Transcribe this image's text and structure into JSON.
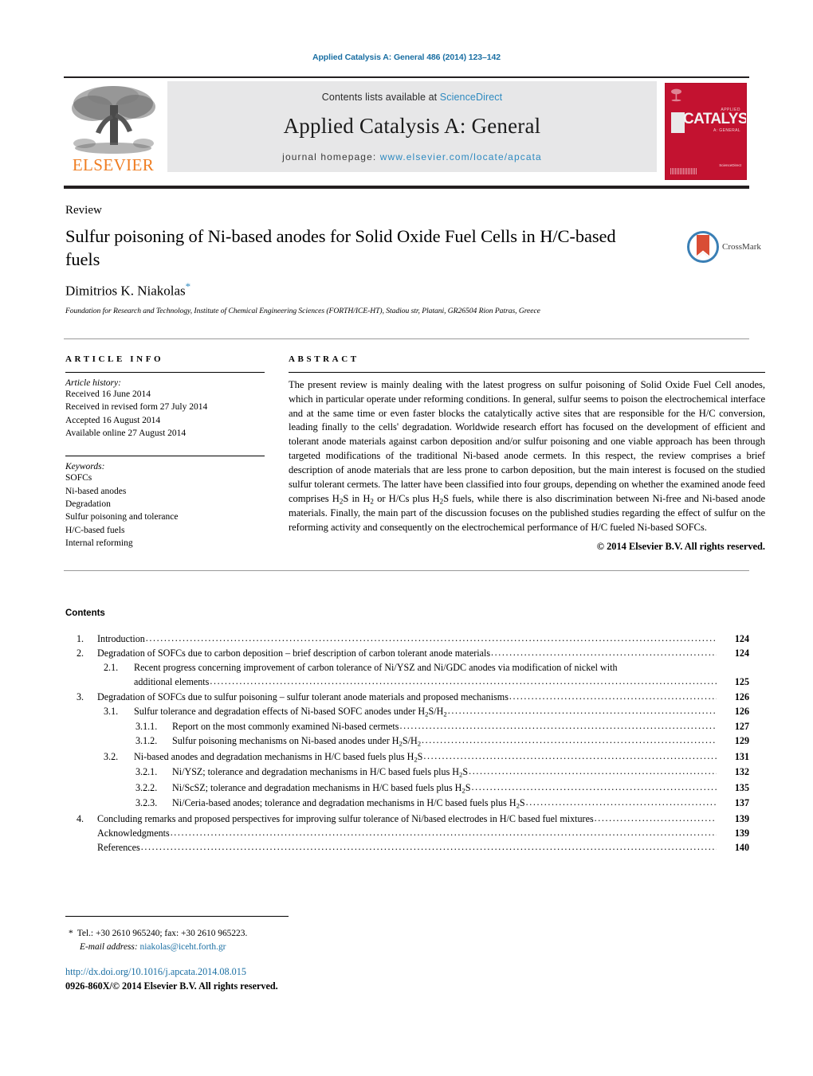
{
  "running_head": "Applied Catalysis A: General 486 (2014) 123–142",
  "masthead": {
    "publisher_name": "ELSEVIER",
    "contents_prefix": "Contents lists available at ",
    "sciencedirect": "ScienceDirect",
    "journal_title": "Applied Catalysis A: General",
    "homepage_label": "journal homepage: ",
    "homepage_url": "www.elsevier.com/locate/apcata",
    "cover": {
      "word": "CATALYSIS",
      "top_text": "APPLIED",
      "sub_text": "A: GENERAL",
      "foot_text": "Available online at\nScienceDirect"
    }
  },
  "article": {
    "kind": "Review",
    "title": "Sulfur poisoning of Ni-based anodes for Solid Oxide Fuel Cells in H/C-based fuels",
    "author": "Dimitrios K. Niakolas",
    "author_marker": "*",
    "affiliation": "Foundation for Research and Technology, Institute of Chemical Engineering Sciences (FORTH/ICE-HT), Stadiou str, Platani, GR26504 Rion Patras, Greece",
    "crossmark_label": "CrossMark"
  },
  "article_info": {
    "heading": "ARTICLE INFO",
    "history_label": "Article history:",
    "history": [
      "Received 16 June 2014",
      "Received in revised form 27 July 2014",
      "Accepted 16 August 2014",
      "Available online 27 August 2014"
    ],
    "keywords_label": "Keywords:",
    "keywords": [
      "SOFCs",
      "Ni-based anodes",
      "Degradation",
      "Sulfur poisoning and tolerance",
      "H/C-based fuels",
      "Internal reforming"
    ]
  },
  "abstract": {
    "heading": "ABSTRACT",
    "body": "The present review is mainly dealing with the latest progress on sulfur poisoning of Solid Oxide Fuel Cell anodes, which in particular operate under reforming conditions. In general, sulfur seems to poison the electrochemical interface and at the same time or even faster blocks the catalytically active sites that are responsible for the H/C conversion, leading finally to the cells' degradation. Worldwide research effort has focused on the development of efficient and tolerant anode materials against carbon deposition and/or sulfur poisoning and one viable approach has been through targeted modifications of the traditional Ni-based anode cermets. In this respect, the review comprises a brief description of anode materials that are less prone to carbon deposition, but the main interest is focused on the studied sulfur tolerant cermets. The latter have been classified into four groups, depending on whether the examined anode feed comprises H2S in H2 or H/Cs plus H2S fuels, while there is also discrimination between Ni-free and Ni-based anode materials. Finally, the main part of the discussion focuses on the published studies regarding the effect of sulfur on the reforming activity and consequently on the electrochemical performance of H/C fueled Ni-based SOFCs.",
    "copyright": "© 2014 Elsevier B.V. All rights reserved."
  },
  "contents": {
    "title": "Contents",
    "entries": [
      {
        "level": 1,
        "number": "1.",
        "text": "Introduction",
        "page": "124"
      },
      {
        "level": 1,
        "number": "2.",
        "text": "Degradation of SOFCs due to carbon deposition – brief description of carbon tolerant anode materials",
        "page": "124"
      },
      {
        "level": 2,
        "number": "2.1.",
        "text": "Recent progress concerning improvement of carbon tolerance of Ni/YSZ and Ni/GDC anodes via modification of nickel with",
        "text2": "additional elements",
        "page": "125"
      },
      {
        "level": 1,
        "number": "3.",
        "text": "Degradation of SOFCs due to sulfur poisoning – sulfur tolerant anode materials and proposed mechanisms",
        "page": "126"
      },
      {
        "level": 2,
        "number": "3.1.",
        "text": "Sulfur tolerance and degradation effects of Ni-based SOFC anodes under H2S/H2",
        "page": "126"
      },
      {
        "level": 3,
        "number": "3.1.1.",
        "text": "Report on the most commonly examined Ni-based cermets",
        "page": "127"
      },
      {
        "level": 3,
        "number": "3.1.2.",
        "text": "Sulfur poisoning mechanisms on Ni-based anodes under H2S/H2",
        "page": "129"
      },
      {
        "level": 2,
        "number": "3.2.",
        "text": "Ni-based anodes and degradation mechanisms in H/C based fuels plus H2S",
        "page": "131"
      },
      {
        "level": 3,
        "number": "3.2.1.",
        "text": "Ni/YSZ; tolerance and degradation mechanisms in H/C based fuels plus H2S",
        "page": "132"
      },
      {
        "level": 3,
        "number": "3.2.2.",
        "text": "Ni/ScSZ; tolerance and degradation mechanisms in H/C based fuels plus H2S",
        "page": "135"
      },
      {
        "level": 3,
        "number": "3.2.3.",
        "text": "Ni/Ceria-based anodes; tolerance and degradation mechanisms in H/C based fuels plus H2S",
        "page": "137"
      },
      {
        "level": 1,
        "number": "4.",
        "text": "Concluding remarks and proposed perspectives for improving sulfur tolerance of Ni/based electrodes in H/C based fuel mixtures",
        "page": "139"
      },
      {
        "level": 0,
        "number": "",
        "text": "Acknowledgments",
        "page": "139"
      },
      {
        "level": 0,
        "number": "",
        "text": "References",
        "page": "140"
      }
    ]
  },
  "footnotes": {
    "marker": "*",
    "tel_line": "Tel.: +30 2610 965240; fax: +30 2610 965223.",
    "email_label": "E-mail address:",
    "email": "niakolas@iceht.forth.gr"
  },
  "footer": {
    "doi": "http://dx.doi.org/10.1016/j.apcata.2014.08.015",
    "issn_line": "0926-860X/© 2014 Elsevier B.V. All rights reserved."
  },
  "colors": {
    "link_blue": "#1a6fa3",
    "sd_blue": "#2e8ac0",
    "elsevier_orange": "#ef7d22",
    "cover_red": "#c31230",
    "band_gray": "#e7e7e8"
  }
}
